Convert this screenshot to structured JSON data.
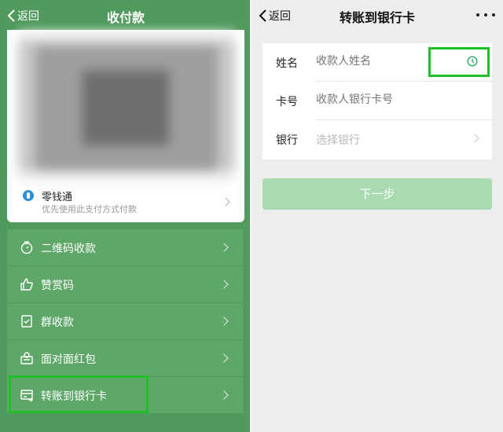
{
  "left": {
    "nav": {
      "back_label": "返回",
      "title": "收付款"
    },
    "lingqiantong": {
      "title": "零钱通",
      "subtitle": "优先使用此支付方式付款"
    },
    "menu": [
      {
        "label": "二维码收款",
        "icon": "coin-timer-icon"
      },
      {
        "label": "赞赏码",
        "icon": "thumbs-up-icon"
      },
      {
        "label": "群收款",
        "icon": "group-receipt-icon"
      },
      {
        "label": "面对面红包",
        "icon": "red-packet-icon"
      },
      {
        "label": "转账到银行卡",
        "icon": "bank-card-icon"
      }
    ]
  },
  "right": {
    "nav": {
      "back_label": "返回",
      "title": "转账到银行卡"
    },
    "form": {
      "name": {
        "label": "姓名",
        "placeholder": "收款人姓名"
      },
      "card": {
        "label": "卡号",
        "placeholder": "收款人银行卡号"
      },
      "bank": {
        "label": "银行",
        "placeholder": "选择银行"
      }
    },
    "next_label": "下一步"
  },
  "colors": {
    "green_bg": "#4f9a5c",
    "menu_item": "#5ea769",
    "highlight": "#1fbf27",
    "button_disabled": "#a8dcb0",
    "clock_icon": "#2aae67"
  }
}
